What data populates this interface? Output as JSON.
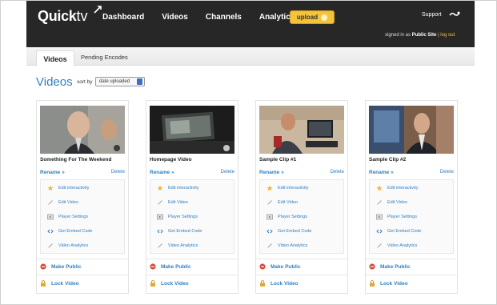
{
  "header": {
    "logo_prefix": "Quick",
    "logo_suffix": "tv",
    "nav": [
      "Dashboard",
      "Videos",
      "Channels",
      "Analytics"
    ],
    "upload_label": "upload",
    "support_label": "Support",
    "signed_in_prefix": "signed in as",
    "account_name": "Public Site",
    "separator": "|",
    "logout_label": "log out"
  },
  "tabs": {
    "active": "Videos",
    "other": "Pending Encodes"
  },
  "page": {
    "title": "Videos",
    "sort_label": "sort by",
    "sort_value": "date uploaded"
  },
  "actions": {
    "rename": "Rename »",
    "delete": "Delete",
    "edit_interactivity": "Edit interactivity",
    "edit_video": "Edit Video",
    "player_settings": "Player Settings",
    "get_embed_code": "Get Embed Code",
    "video_analytics": "Video Analytics",
    "make_public": "Make Public",
    "lock_video": "Lock Video"
  },
  "videos": [
    {
      "title": "Something For The Weekend"
    },
    {
      "title": "Homepage Video"
    },
    {
      "title": "Sample Clip #1"
    },
    {
      "title": "Sample Clip #2"
    }
  ],
  "colors": {
    "header_bg": "#272727",
    "accent_blue": "#2f7fc0",
    "upload_yellow": "#f3c33a",
    "make_public_red": "#d8453a",
    "lock_gold": "#e0a82a"
  }
}
